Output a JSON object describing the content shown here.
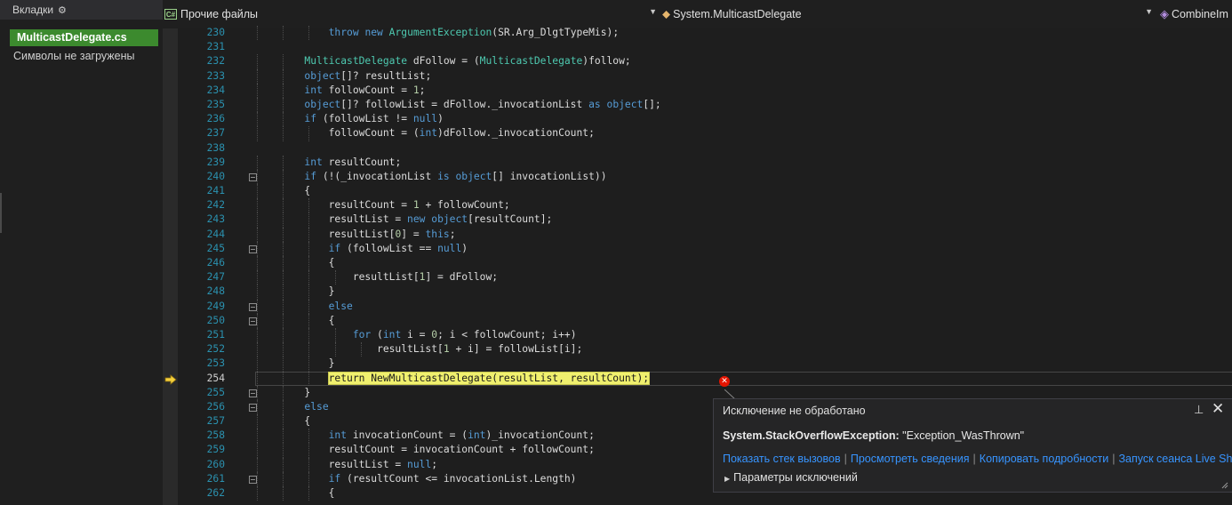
{
  "tabs_panel": {
    "title": "Вкладки",
    "active_file": "MulticastDelegate.cs",
    "symbols_status": "Символы не загружены"
  },
  "navbar": {
    "project": "Прочие файлы",
    "class": "System.MulticastDelegate",
    "member": "CombineIm",
    "project_badge": "C#"
  },
  "editor": {
    "current_line": 254,
    "lines": [
      {
        "num": 230,
        "code": "            throw new ArgumentException(SR.Arg_DlgtTypeMis);"
      },
      {
        "num": 231,
        "code": ""
      },
      {
        "num": 232,
        "code": "        MulticastDelegate dFollow = (MulticastDelegate)follow;"
      },
      {
        "num": 233,
        "code": "        object[]? resultList;"
      },
      {
        "num": 234,
        "code": "        int followCount = 1;"
      },
      {
        "num": 235,
        "code": "        object[]? followList = dFollow._invocationList as object[];"
      },
      {
        "num": 236,
        "code": "        if (followList != null)"
      },
      {
        "num": 237,
        "code": "            followCount = (int)dFollow._invocationCount;"
      },
      {
        "num": 238,
        "code": ""
      },
      {
        "num": 239,
        "code": "        int resultCount;"
      },
      {
        "num": 240,
        "code": "        if (!(_invocationList is object[] invocationList))"
      },
      {
        "num": 241,
        "code": "        {"
      },
      {
        "num": 242,
        "code": "            resultCount = 1 + followCount;"
      },
      {
        "num": 243,
        "code": "            resultList = new object[resultCount];"
      },
      {
        "num": 244,
        "code": "            resultList[0] = this;"
      },
      {
        "num": 245,
        "code": "            if (followList == null)"
      },
      {
        "num": 246,
        "code": "            {"
      },
      {
        "num": 247,
        "code": "                resultList[1] = dFollow;"
      },
      {
        "num": 248,
        "code": "            }"
      },
      {
        "num": 249,
        "code": "            else"
      },
      {
        "num": 250,
        "code": "            {"
      },
      {
        "num": 251,
        "code": "                for (int i = 0; i < followCount; i++)"
      },
      {
        "num": 252,
        "code": "                    resultList[1 + i] = followList[i];"
      },
      {
        "num": 253,
        "code": "            }"
      },
      {
        "num": 254,
        "code": "            return NewMulticastDelegate(resultList, resultCount);"
      },
      {
        "num": 255,
        "code": "        }"
      },
      {
        "num": 256,
        "code": "        else"
      },
      {
        "num": 257,
        "code": "        {"
      },
      {
        "num": 258,
        "code": "            int invocationCount = (int)_invocationCount;"
      },
      {
        "num": 259,
        "code": "            resultCount = invocationCount + followCount;"
      },
      {
        "num": 260,
        "code": "            resultList = null;"
      },
      {
        "num": 261,
        "code": "            if (resultCount <= invocationList.Length)"
      },
      {
        "num": 262,
        "code": "            {"
      }
    ],
    "fold_lines": [
      240,
      245,
      249,
      250,
      255,
      256,
      261
    ]
  },
  "exception_popup": {
    "title": "Исключение не обработано",
    "exception_type": "System.StackOverflowException:",
    "exception_message": "\"Exception_WasThrown\"",
    "links": [
      "Показать стек вызовов",
      "Просмотреть сведения",
      "Копировать подробности",
      "Запуск сеанса Live Share"
    ],
    "params_label": "Параметры исключений"
  },
  "colors": {
    "active_tab": "#3c8a2e",
    "keyword": "#569cd6",
    "type": "#4ec9b0",
    "number": "#b5cea8",
    "line_number": "#2b91af",
    "link": "#3794ff",
    "error": "#e51400",
    "current_statement": "#f0f06e"
  }
}
